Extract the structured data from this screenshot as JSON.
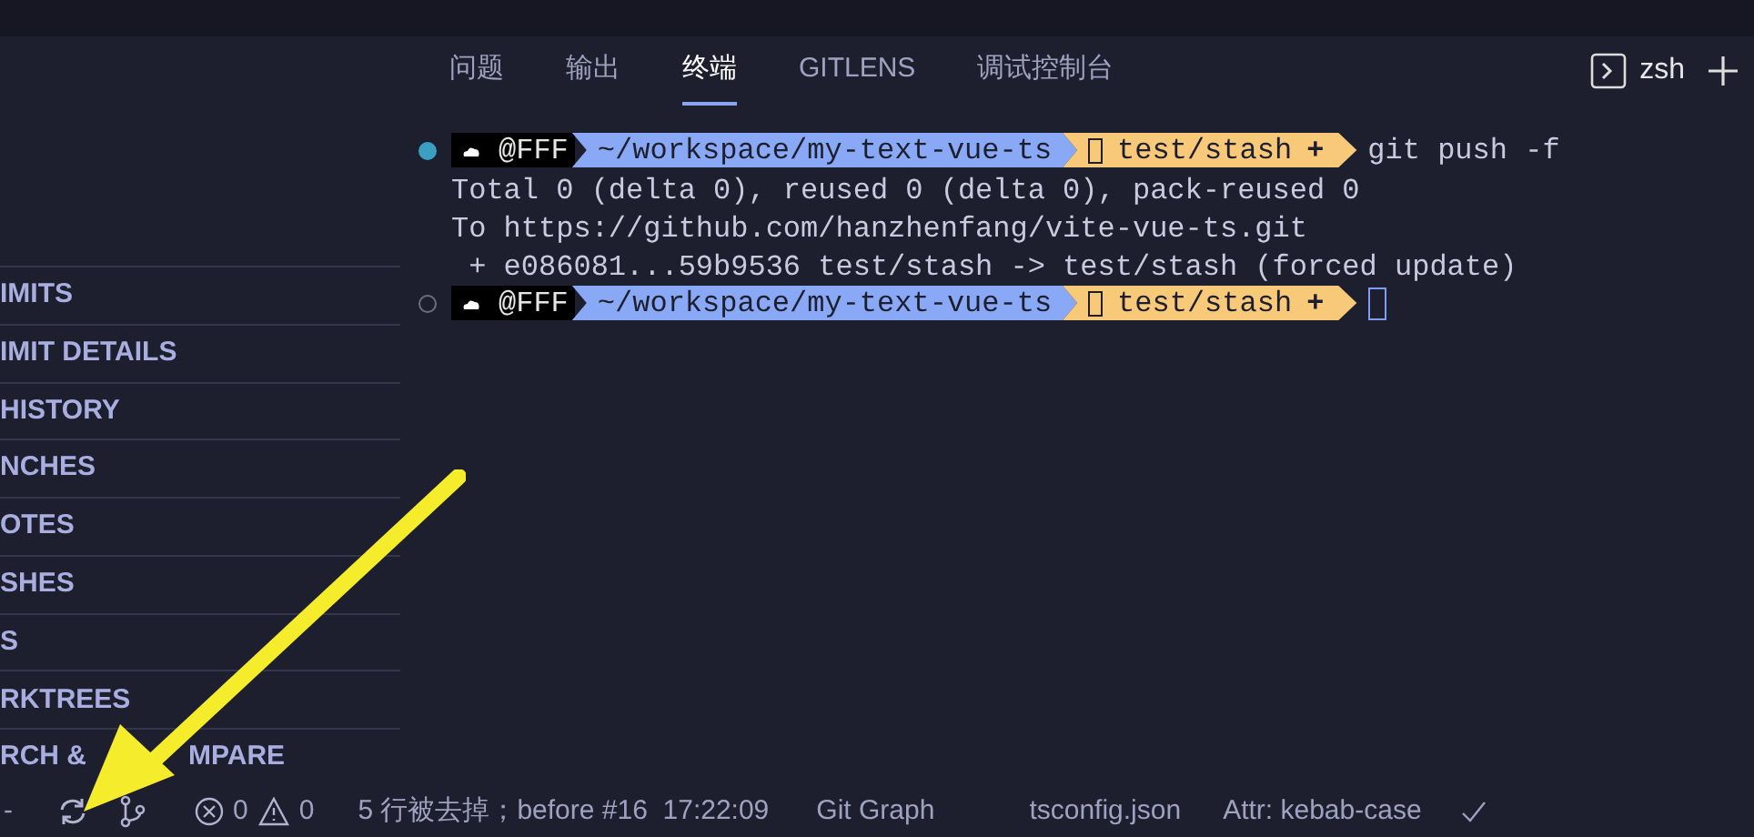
{
  "sidebar": {
    "items": [
      {
        "label": "IMITS"
      },
      {
        "label": "IMIT DETAILS"
      },
      {
        "label": "HISTORY"
      },
      {
        "label": "NCHES"
      },
      {
        "label": "OTES"
      },
      {
        "label": "SHES"
      },
      {
        "label": "S"
      },
      {
        "label": "RKTREES"
      },
      {
        "label": "RCH &",
        "label_tail": "MPARE"
      }
    ]
  },
  "panel_tabs": [
    {
      "label": "问题",
      "selected": false
    },
    {
      "label": "输出",
      "selected": false
    },
    {
      "label": "终端",
      "selected": true
    },
    {
      "label": "GITLENS",
      "selected": false
    },
    {
      "label": "调试控制台",
      "selected": false
    }
  ],
  "terminal_name": "zsh",
  "terminal": [
    {
      "kind": "prompt",
      "active": true,
      "user": "@FFF",
      "path": "~/workspace/my-text-vue-ts",
      "branch": "test/stash",
      "dirty": "+",
      "command": "git push -f"
    },
    {
      "kind": "output",
      "text": "Total 0 (delta 0), reused 0 (delta 0), pack-reused 0"
    },
    {
      "kind": "output",
      "text": "To https://github.com/hanzhenfang/vite-vue-ts.git"
    },
    {
      "kind": "output",
      "text": " + e086081...59b9536 test/stash -> test/stash (forced update)"
    },
    {
      "kind": "prompt",
      "active": false,
      "user": "@FFF",
      "path": "~/workspace/my-text-vue-ts",
      "branch": "test/stash",
      "dirty": "+",
      "cursor": true
    }
  ],
  "status_bar": {
    "left_mark": "-",
    "errors": "0",
    "warnings": "0",
    "message": "5 行被去掉；before #16  17:22:09",
    "git_graph": "Git Graph",
    "file": "tsconfig.json",
    "attr": "Attr: kebab-case"
  }
}
